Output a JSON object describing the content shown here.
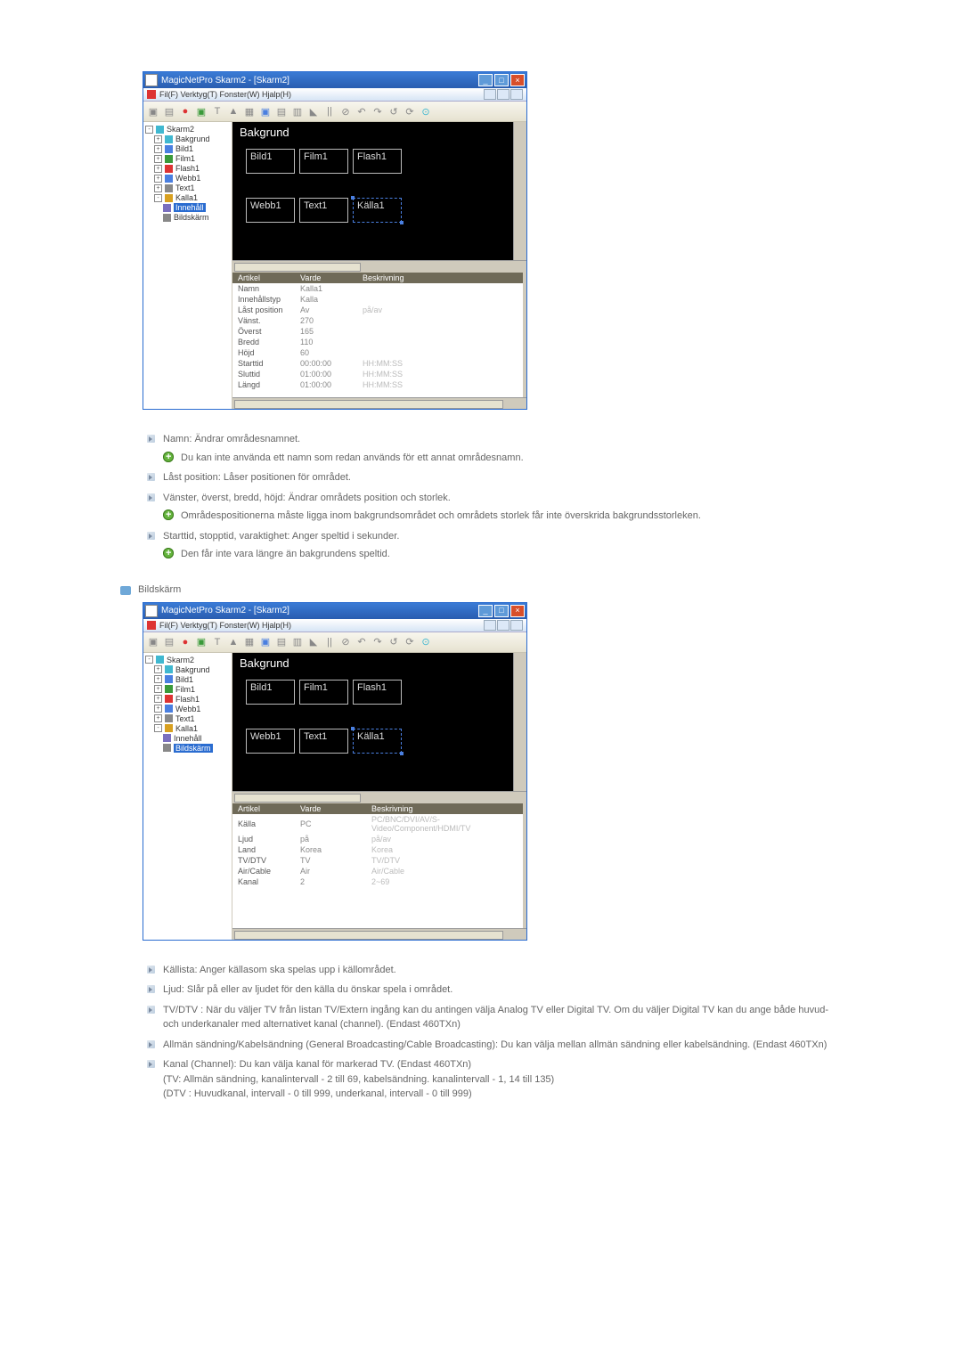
{
  "app": {
    "title": "MagicNetPro Skarm2 - [Skarm2]",
    "menu": "Fil(F)  Verktyg(T)  Fonster(W)  Hjalp(H)"
  },
  "tree": {
    "root": "Skarm2",
    "items": [
      {
        "label": "Bakgrund",
        "icon": "i-cyan"
      },
      {
        "label": "Bild1",
        "icon": "i-blue"
      },
      {
        "label": "Film1",
        "icon": "i-green"
      },
      {
        "label": "Flash1",
        "icon": "i-red"
      },
      {
        "label": "Webb1",
        "icon": "i-blue"
      },
      {
        "label": "Text1",
        "icon": "i-grey"
      },
      {
        "label": "Kalla1",
        "icon": "i-yellow"
      }
    ],
    "sub1": {
      "a": "Innehåll",
      "b": "Bildskärm"
    },
    "sub2": {
      "a": "Innehåll",
      "b": "Bildskärm"
    }
  },
  "canvas": {
    "bg": "Bakgrund",
    "r1": "Bild1",
    "r2": "Film1",
    "r3": "Flash1",
    "r4": "Webb1",
    "r5": "Text1",
    "r6": "Källa1"
  },
  "props1": {
    "h1": "Artikel",
    "h2": "Varde",
    "h3": "Beskrivning",
    "rows": [
      {
        "k": "Namn",
        "v": "Kalla1",
        "d": ""
      },
      {
        "k": "Innehållstyp",
        "v": "Kalla",
        "d": ""
      },
      {
        "k": "Låst position",
        "v": "Av",
        "d": "på/av"
      },
      {
        "k": "Vänst.",
        "v": "270",
        "d": ""
      },
      {
        "k": "Överst",
        "v": "165",
        "d": ""
      },
      {
        "k": "Bredd",
        "v": "110",
        "d": ""
      },
      {
        "k": "Höjd",
        "v": "60",
        "d": ""
      },
      {
        "k": "Starttid",
        "v": "00:00:00",
        "d": "HH:MM:SS"
      },
      {
        "k": "Sluttid",
        "v": "01:00:00",
        "d": "HH:MM:SS"
      },
      {
        "k": "Längd",
        "v": "01:00:00",
        "d": "HH:MM:SS"
      }
    ]
  },
  "props2": {
    "h1": "Artikel",
    "h2": "Varde",
    "h3": "Beskrivning",
    "rows": [
      {
        "k": "Källa",
        "v": "PC",
        "d": "PC/BNC/DVI/AV/S-Video/Component/HDMI/TV"
      },
      {
        "k": "Ljud",
        "v": "på",
        "d": "på/av"
      },
      {
        "k": "Land",
        "v": "Korea",
        "d": "Korea"
      },
      {
        "k": "TV/DTV",
        "v": "TV",
        "d": "TV/DTV"
      },
      {
        "k": "Air/Cable",
        "v": "Air",
        "d": "Air/Cable"
      },
      {
        "k": "Kanal",
        "v": "2",
        "d": "2~69"
      }
    ]
  },
  "body1": {
    "i1": "Namn: Ändrar områdesnamnet.",
    "i1s": "Du kan inte använda ett namn som redan används för ett annat områdesnamn.",
    "i2": "Låst position: Låser positionen för området.",
    "i3": "Vänster, överst, bredd, höjd: Ändrar områdets position och storlek.",
    "i3s": "Områdespositionerna måste ligga inom bakgrundsområdet och områdets storlek får inte överskrida bakgrundsstorleken.",
    "i4": "Starttid, stopptid, varaktighet: Anger speltid i sekunder.",
    "i4s": "Den får inte vara längre än bakgrundens speltid."
  },
  "section2": "Bildskärm",
  "body2": {
    "i1": "Källista: Anger källasom ska spelas upp i källområdet.",
    "i2": "Ljud: Slår på eller av ljudet för den källa du önskar spela i området.",
    "i3": "TV/DTV : När du väljer TV från listan TV/Extern ingång kan du antingen välja Analog TV eller Digital TV. Om du väljer Digital TV kan du ange både huvud- och underkanaler med alternativet kanal (channel). (Endast 460TXn)",
    "i4": "Allmän sändning/Kabelsändning (General Broadcasting/Cable Broadcasting): Du kan välja mellan allmän sändning eller kabelsändning. (Endast 460TXn)",
    "i5": "Kanal (Channel): Du kan välja kanal för markerad TV. (Endast 460TXn)",
    "i5a": "(TV: Allmän sändning, kanalintervall - 2 till 69, kabelsändning. kanalintervall - 1, 14 till 135)",
    "i5b": "(DTV : Huvudkanal, intervall - 0 till 999, underkanal, intervall - 0 till 999)"
  }
}
